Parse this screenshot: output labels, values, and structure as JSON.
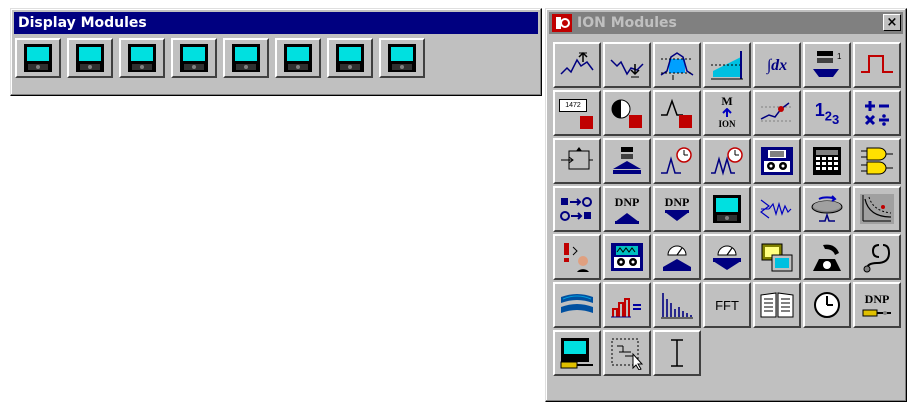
{
  "display_window": {
    "title": "Display Modules",
    "modules_count_visible": 8
  },
  "ion_window": {
    "title": "ION Modules",
    "close_glyph": "×"
  },
  "icon_text": {
    "integrator": "∫dx",
    "counter_label": "1472",
    "ion_m": "M",
    "ion_ion": "ION",
    "digits": "1",
    "digits_sub2": "2",
    "digits_sub3": "3",
    "dnp_1": "DNP",
    "dnp_2": "DNP",
    "dnp_3": "DNP",
    "fft": "FFT"
  },
  "colors": {
    "titlebar_active": "#000080",
    "titlebar_inactive": "#808080",
    "face": "#c0c0c0",
    "display_screen": "#00e0e0",
    "accent_blue": "#0000c0",
    "accent_red": "#c00000"
  },
  "icons": [
    "display-module-icon",
    "display-module-icon",
    "display-module-icon",
    "display-module-icon",
    "display-module-icon",
    "display-module-icon",
    "display-module-icon",
    "display-module-icon",
    "maximum-icon",
    "minimum-icon",
    "setpoint-icon",
    "threshold-icon",
    "integrator-icon",
    "sort-icon",
    "pulse-icon",
    "counter-icon",
    "logic-control-icon",
    "peak-icon",
    "ion-module-icon",
    "trend-icon",
    "digits-icon",
    "arithmetic-icon",
    "feedback-icon",
    "recorder-icon",
    "periodic-timer-icon",
    "one-shot-timer-icon",
    "data-recorder-icon",
    "calendar-icon",
    "and-or-icon",
    "digital-io-icon",
    "dnp-slave-import-icon",
    "dnp-slave-export-icon",
    "display-module-icon",
    "wave-recorder-icon",
    "analog-disc-icon",
    "scope-icon",
    "alarm-icon",
    "waveform-recorder-icon",
    "meter-import-icon",
    "meter-export-icon",
    "distributed-io-icon",
    "telephone-icon",
    "stethoscope-icon",
    "communications-icon",
    "bar-graph-icon",
    "harmonics-icon",
    "fft-icon",
    "log-book-icon",
    "clock-icon",
    "dnp-options-icon",
    "display-options-icon",
    "selection-icon",
    "text-cursor-icon"
  ]
}
